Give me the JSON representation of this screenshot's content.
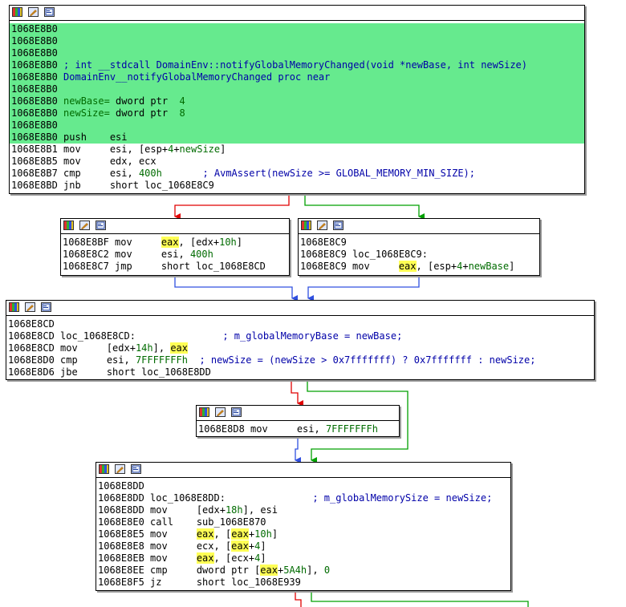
{
  "blocks": [
    {
      "lines": [
        {
          "segs": [
            {
              "t": "1068E8B0"
            }
          ],
          "hl": true
        },
        {
          "segs": [
            {
              "t": "1068E8B0"
            }
          ],
          "hl": true
        },
        {
          "segs": [
            {
              "t": "1068E8B0"
            }
          ],
          "hl": true
        },
        {
          "segs": [
            {
              "t": "1068E8B0 "
            },
            {
              "t": "; int __stdcall DomainEnv::notifyGlobalMemoryChanged(void *newBase, int newSize)",
              "c": "blue"
            }
          ],
          "hl": true
        },
        {
          "segs": [
            {
              "t": "1068E8B0 "
            },
            {
              "t": "DomainEnv__notifyGlobalMemoryChanged proc near",
              "c": "blue"
            }
          ],
          "hl": true
        },
        {
          "segs": [
            {
              "t": "1068E8B0"
            }
          ],
          "hl": true
        },
        {
          "segs": [
            {
              "t": "1068E8B0 "
            },
            {
              "t": "newBase=",
              "c": "green"
            },
            {
              "t": " dword ptr  "
            },
            {
              "t": "4",
              "c": "green"
            }
          ],
          "hl": true
        },
        {
          "segs": [
            {
              "t": "1068E8B0 "
            },
            {
              "t": "newSize=",
              "c": "green"
            },
            {
              "t": " dword ptr  "
            },
            {
              "t": "8",
              "c": "green"
            }
          ],
          "hl": true
        },
        {
          "segs": [
            {
              "t": "1068E8B0"
            }
          ],
          "hl": true
        },
        {
          "segs": [
            {
              "t": "1068E8B0 push    esi"
            }
          ],
          "hl": true
        },
        {
          "segs": [
            {
              "t": "1068E8B1 mov     esi, [esp+"
            },
            {
              "t": "4",
              "c": "green"
            },
            {
              "t": "+"
            },
            {
              "t": "newSize",
              "c": "green"
            },
            {
              "t": "]"
            }
          ]
        },
        {
          "segs": [
            {
              "t": "1068E8B5 mov     edx, ecx"
            }
          ]
        },
        {
          "segs": [
            {
              "t": "1068E8B7 cmp     esi, "
            },
            {
              "t": "400h",
              "c": "green"
            },
            {
              "t": "       "
            },
            {
              "t": "; AvmAssert(newSize >= GLOBAL_MEMORY_MIN_SIZE);",
              "c": "blue"
            }
          ]
        },
        {
          "segs": [
            {
              "t": "1068E8BD jnb     short loc_1068E8C9"
            }
          ]
        }
      ]
    },
    {
      "lines": [
        {
          "segs": [
            {
              "t": "1068E8BF mov     "
            },
            {
              "t": "eax",
              "c": "yel"
            },
            {
              "t": ", [edx+"
            },
            {
              "t": "10h",
              "c": "green"
            },
            {
              "t": "]"
            }
          ]
        },
        {
          "segs": [
            {
              "t": "1068E8C2 mov     esi, "
            },
            {
              "t": "400h",
              "c": "green"
            }
          ]
        },
        {
          "segs": [
            {
              "t": "1068E8C7 jmp     short loc_1068E8CD"
            }
          ]
        }
      ]
    },
    {
      "lines": [
        {
          "segs": [
            {
              "t": "1068E8C9"
            }
          ]
        },
        {
          "segs": [
            {
              "t": "1068E8C9 loc_1068E8C9:"
            }
          ]
        },
        {
          "segs": [
            {
              "t": "1068E8C9 mov     "
            },
            {
              "t": "eax",
              "c": "yel"
            },
            {
              "t": ", [esp+"
            },
            {
              "t": "4",
              "c": "green"
            },
            {
              "t": "+"
            },
            {
              "t": "newBase",
              "c": "green"
            },
            {
              "t": "]"
            }
          ]
        }
      ]
    },
    {
      "lines": [
        {
          "segs": [
            {
              "t": "1068E8CD"
            }
          ]
        },
        {
          "segs": [
            {
              "t": "1068E8CD loc_1068E8CD:"
            },
            {
              "t": "               "
            },
            {
              "t": "; m_globalMemoryBase = newBase;",
              "c": "blue"
            }
          ]
        },
        {
          "segs": [
            {
              "t": "1068E8CD mov     [edx+"
            },
            {
              "t": "14h",
              "c": "green"
            },
            {
              "t": "], "
            },
            {
              "t": "eax",
              "c": "yel"
            }
          ]
        },
        {
          "segs": [
            {
              "t": "1068E8D0 cmp     esi, "
            },
            {
              "t": "7FFFFFFFh",
              "c": "green"
            },
            {
              "t": "  "
            },
            {
              "t": "; newSize = (newSize > 0x7fffffff) ? 0x7fffffff : newSize;",
              "c": "blue"
            }
          ]
        },
        {
          "segs": [
            {
              "t": "1068E8D6 jbe     short loc_1068E8DD"
            }
          ]
        }
      ]
    },
    {
      "lines": [
        {
          "segs": [
            {
              "t": "1068E8D8 mov     esi, "
            },
            {
              "t": "7FFFFFFFh",
              "c": "green"
            }
          ]
        }
      ]
    },
    {
      "lines": [
        {
          "segs": [
            {
              "t": "1068E8DD"
            }
          ]
        },
        {
          "segs": [
            {
              "t": "1068E8DD loc_1068E8DD:"
            },
            {
              "t": "               "
            },
            {
              "t": "; m_globalMemorySize = newSize;",
              "c": "blue"
            }
          ]
        },
        {
          "segs": [
            {
              "t": "1068E8DD mov     [edx+"
            },
            {
              "t": "18h",
              "c": "green"
            },
            {
              "t": "], esi"
            }
          ]
        },
        {
          "segs": [
            {
              "t": "1068E8E0 call    sub_1068E870"
            }
          ]
        },
        {
          "segs": [
            {
              "t": "1068E8E5 mov     "
            },
            {
              "t": "eax",
              "c": "yel"
            },
            {
              "t": ", ["
            },
            {
              "t": "eax",
              "c": "yel"
            },
            {
              "t": "+"
            },
            {
              "t": "10h",
              "c": "green"
            },
            {
              "t": "]"
            }
          ]
        },
        {
          "segs": [
            {
              "t": "1068E8E8 mov     ecx, ["
            },
            {
              "t": "eax",
              "c": "yel"
            },
            {
              "t": "+"
            },
            {
              "t": "4",
              "c": "green"
            },
            {
              "t": "]"
            }
          ]
        },
        {
          "segs": [
            {
              "t": "1068E8EB mov     "
            },
            {
              "t": "eax",
              "c": "yel"
            },
            {
              "t": ", [ecx+"
            },
            {
              "t": "4",
              "c": "green"
            },
            {
              "t": "]"
            }
          ]
        },
        {
          "segs": [
            {
              "t": "1068E8EE cmp     dword ptr ["
            },
            {
              "t": "eax",
              "c": "yel"
            },
            {
              "t": "+"
            },
            {
              "t": "5A4h",
              "c": "green"
            },
            {
              "t": "], "
            },
            {
              "t": "0",
              "c": "green"
            }
          ]
        },
        {
          "segs": [
            {
              "t": "1068E8F5 jz      short loc_1068E939"
            }
          ]
        }
      ]
    }
  ],
  "colors": {
    "highlight": "#66ea8e",
    "true_branch": "#00a000",
    "false_branch": "#e00000",
    "unconditional": "#3050e0",
    "register_highlight": "#ffff55"
  }
}
